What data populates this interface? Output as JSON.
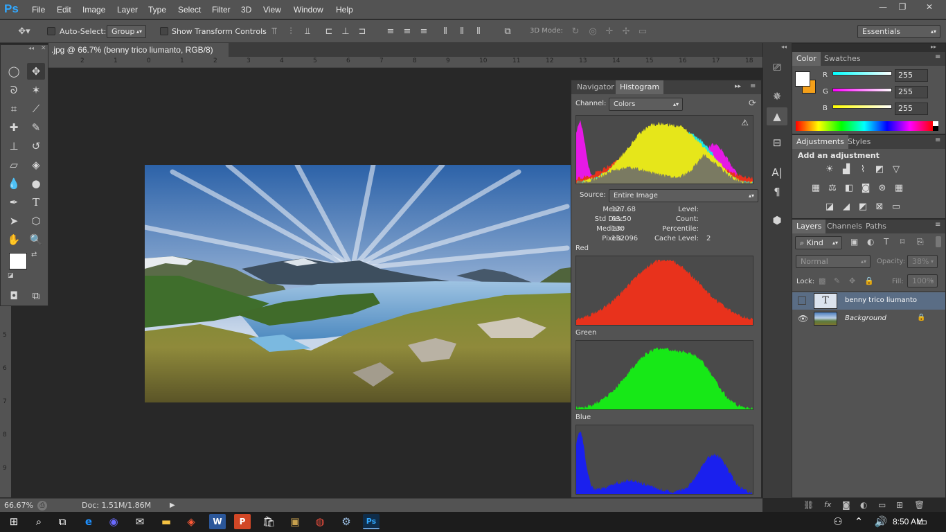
{
  "app": {
    "logo": "Ps"
  },
  "menu": [
    "File",
    "Edit",
    "Image",
    "Layer",
    "Type",
    "Select",
    "Filter",
    "3D",
    "View",
    "Window",
    "Help"
  ],
  "window_controls": {
    "minimize": "—",
    "restore": "❐",
    "close": "✕"
  },
  "options": {
    "auto_select_label": "Auto-Select:",
    "auto_select_value": "Group",
    "show_transform_label": "Show Transform Controls",
    "mode_3d_label": "3D Mode:",
    "workspace": "Essentials"
  },
  "document": {
    "tab_title": ".jpg @ 66.7% (benny trico liumanto, RGB/8) *",
    "zoom": "66.67%",
    "doc_size": "Doc: 1.51M/1.86M"
  },
  "rulers": {
    "h": [
      "2",
      "1",
      "0",
      "1",
      "2",
      "3",
      "4",
      "5",
      "6",
      "7",
      "8",
      "9",
      "10",
      "11",
      "12",
      "13",
      "14",
      "15",
      "16",
      "17",
      "18"
    ],
    "v": [
      "5",
      "6",
      "7",
      "8",
      "9"
    ]
  },
  "histogram": {
    "tabs": [
      "Navigator",
      "Histogram"
    ],
    "channel_label": "Channel:",
    "channel_value": "Colors",
    "source_label": "Source:",
    "source_value": "Entire Image",
    "stats_left": [
      {
        "label": "Mean:",
        "value": "127.68"
      },
      {
        "label": "Std Dev:",
        "value": "63.50"
      },
      {
        "label": "Median:",
        "value": "130"
      },
      {
        "label": "Pixels:",
        "value": "132096"
      }
    ],
    "stats_right": [
      {
        "label": "Level:",
        "value": ""
      },
      {
        "label": "Count:",
        "value": ""
      },
      {
        "label": "Percentile:",
        "value": ""
      },
      {
        "label": "Cache Level:",
        "value": "2"
      }
    ],
    "channels": [
      "Red",
      "Green",
      "Blue"
    ],
    "warning_glyph": "⚠",
    "colors": {
      "red": "#e8321c",
      "green": "#17e817",
      "blue": "#1a20ee",
      "yellow": "#e6e61a",
      "cyan": "#19e6e6",
      "magenta": "#e619e6"
    }
  },
  "color_panel": {
    "tabs": [
      "Color",
      "Swatches"
    ],
    "sliders": [
      {
        "label": "R",
        "value": "255"
      },
      {
        "label": "G",
        "value": "255"
      },
      {
        "label": "B",
        "value": "255"
      }
    ],
    "foreground": "#ffffff",
    "background": "#f5a019"
  },
  "adjustments_panel": {
    "tabs": [
      "Adjustments",
      "Styles"
    ],
    "heading": "Add an adjustment"
  },
  "layers_panel": {
    "tabs": [
      "Layers",
      "Channels",
      "Paths"
    ],
    "filter_kind": "Kind",
    "blend_mode": "Normal",
    "opacity_label": "Opacity:",
    "opacity_value": "38%",
    "lock_label": "Lock:",
    "fill_label": "Fill:",
    "fill_value": "100%",
    "layers": [
      {
        "name": "benny trico liumanto",
        "type": "text"
      },
      {
        "name": "Background",
        "type": "image"
      }
    ]
  },
  "taskbar": {
    "time": "8:50 AM"
  }
}
